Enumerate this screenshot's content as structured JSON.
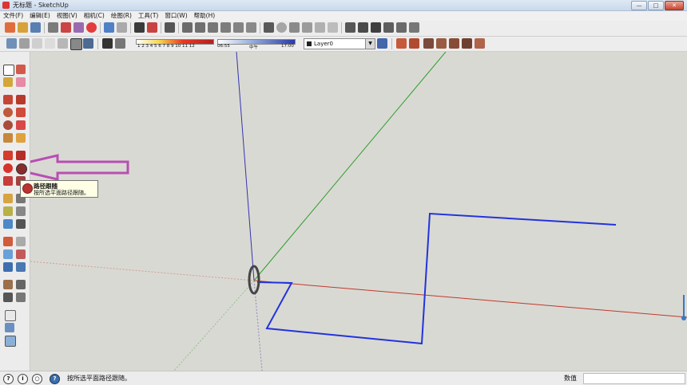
{
  "window": {
    "title": "无标题 - SketchUp",
    "minimize_label": "—",
    "maximize_label": "□",
    "close_label": "✕"
  },
  "menu": [
    {
      "label": "文件(F)"
    },
    {
      "label": "编辑(E)"
    },
    {
      "label": "视图(V)"
    },
    {
      "label": "相机(C)"
    },
    {
      "label": "绘图(R)"
    },
    {
      "label": "工具(T)"
    },
    {
      "label": "窗口(W)"
    },
    {
      "label": "帮助(H)"
    }
  ],
  "shadow": {
    "months_label": "1 2 3 4 5 6 7 8 9 10 11 12",
    "time_start": "06:55",
    "noon_label": "中午",
    "time_end": "17:00"
  },
  "layer": {
    "current": "Layer0"
  },
  "tooltip": {
    "title": "路径跟随",
    "description": "按所选平面路径跟随。"
  },
  "status": {
    "message": "按所选平面路径跟随。",
    "measurements_label": "数值",
    "measurements_value": ""
  },
  "colors": {
    "path": "#2233dd",
    "red_axis": "#c0392b",
    "green_axis": "#2ea02e",
    "blue_axis": "#3434b0",
    "arrow": "#b74fb3"
  }
}
